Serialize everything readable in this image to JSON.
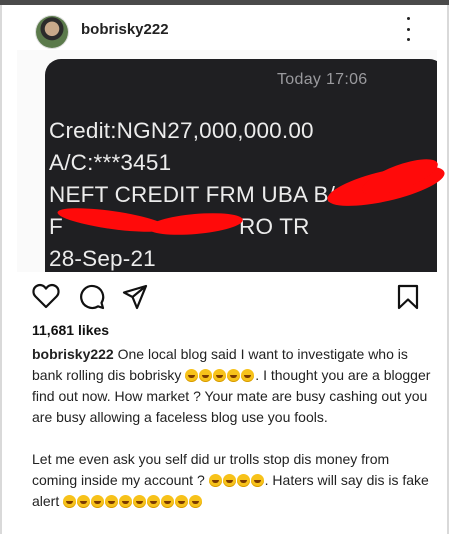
{
  "post": {
    "username": "bobrisky222",
    "likes": "11,681 likes"
  },
  "sms": {
    "time": "Today 17:06",
    "line1": "Credit:NGN27,000,000.00",
    "line2": "A/C:***3451",
    "line3": "NEFT CREDIT FRM UBA B/",
    "line4_start": "F",
    "line4_end": "RO TR",
    "line5": "28-Sep-21"
  },
  "caption": {
    "p1_before": "One local blog said I want to investigate who is bank rolling dis bobrisky",
    "p1_after": ". I thought you are a blogger find out now. How market ? Your mate are busy cashing out you are busy allowing a faceless blog use you fools.",
    "p2_before": "Let me even ask you self did ur trolls stop dis money from coming inside my account ?",
    "p2_middle": ". Haters will say dis is fake alert"
  },
  "icons": {
    "more": "more-options-icon",
    "like": "heart-icon",
    "comment": "comment-icon",
    "share": "share-icon",
    "save": "bookmark-icon",
    "emoji": "laughing-emoji"
  },
  "colors": {
    "redaction": "#ff0a0a",
    "sms_bubble": "#1f1f22"
  }
}
